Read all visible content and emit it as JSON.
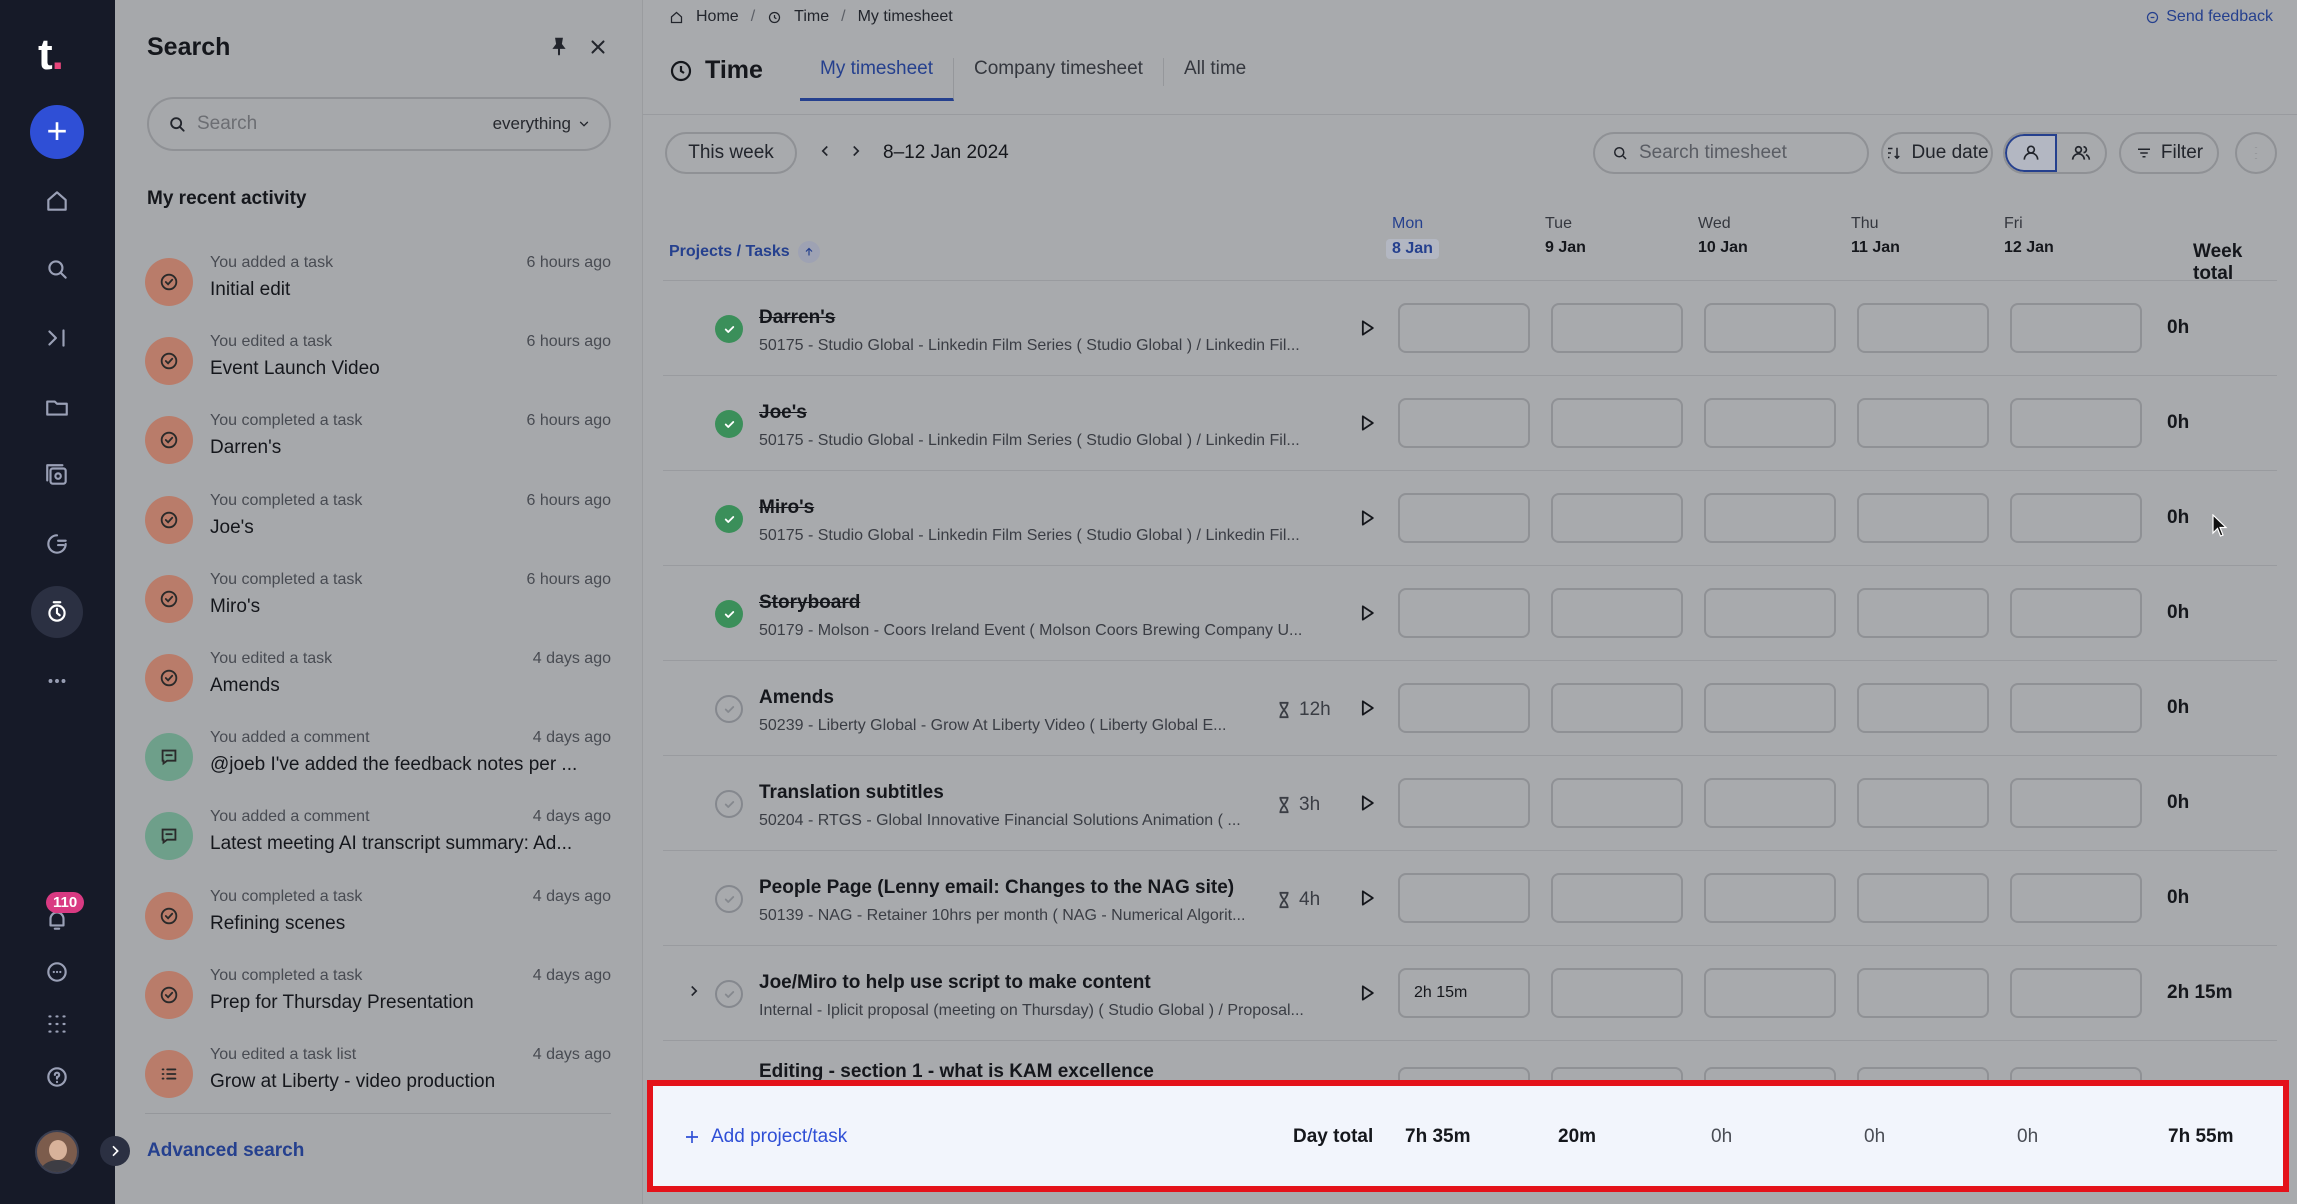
{
  "rail": {
    "logo": "t",
    "logo_dot": ".",
    "notification_count": "110",
    "icons": [
      "home-icon",
      "search-icon",
      "jump-icon",
      "folder-icon",
      "gallery-icon",
      "refresh-chat-icon",
      "timer-icon",
      "more-icon",
      "bell-icon",
      "chat-icon",
      "apps-grid-icon",
      "help-icon"
    ]
  },
  "search_panel": {
    "title": "Search",
    "search_placeholder": "Search",
    "scope": "everything",
    "section_title": "My recent activity",
    "advanced_search": "Advanced search",
    "activity": [
      {
        "meta": "You added a task",
        "when": "6 hours ago",
        "name": "Initial edit",
        "kind": "task"
      },
      {
        "meta": "You edited a task",
        "when": "6 hours ago",
        "name": "Event Launch Video",
        "kind": "task"
      },
      {
        "meta": "You completed a task",
        "when": "6 hours ago",
        "name": "Darren's",
        "kind": "task"
      },
      {
        "meta": "You completed a task",
        "when": "6 hours ago",
        "name": "Joe's",
        "kind": "task"
      },
      {
        "meta": "You completed a task",
        "when": "6 hours ago",
        "name": "Miro's",
        "kind": "task"
      },
      {
        "meta": "You edited a task",
        "when": "4 days ago",
        "name": "Amends",
        "kind": "task"
      },
      {
        "meta": "You added a comment",
        "when": "4 days ago",
        "name": "@joeb I've added the feedback notes per ...",
        "kind": "comment"
      },
      {
        "meta": "You added a comment",
        "when": "4 days ago",
        "name": "Latest meeting AI transcript summary: Ad...",
        "kind": "comment"
      },
      {
        "meta": "You completed a task",
        "when": "4 days ago",
        "name": "Refining scenes",
        "kind": "task"
      },
      {
        "meta": "You completed a task",
        "when": "4 days ago",
        "name": "Prep for Thursday Presentation",
        "kind": "task"
      },
      {
        "meta": "You edited a task list",
        "when": "4 days ago",
        "name": "Grow at Liberty - video production",
        "kind": "list"
      }
    ]
  },
  "main": {
    "breadcrumb": [
      "Home",
      "Time",
      "My timesheet"
    ],
    "send_feedback": "Send feedback",
    "title": "Time",
    "tabs": [
      "My timesheet",
      "Company timesheet",
      "All time"
    ],
    "toolbar": {
      "this_week": "This week",
      "range": "8–12 Jan 2024",
      "search_placeholder": "Search timesheet",
      "sort": "Due date",
      "filter": "Filter"
    },
    "header": {
      "projects_tasks": "Projects / Tasks",
      "week_total": "Week total",
      "days": [
        {
          "name": "Mon",
          "date": "8 Jan"
        },
        {
          "name": "Tue",
          "date": "9 Jan"
        },
        {
          "name": "Wed",
          "date": "10 Jan"
        },
        {
          "name": "Thu",
          "date": "11 Jan"
        },
        {
          "name": "Fri",
          "date": "12 Jan"
        }
      ]
    },
    "rows": [
      {
        "task": "Darren's",
        "project": "50175 - Studio Global - Linkedin Film Series ( Studio Global ) / Linkedin Fil...",
        "done": true,
        "estimate": "",
        "cells": [
          "",
          "",
          "",
          "",
          ""
        ],
        "total": "0h"
      },
      {
        "task": "Joe's",
        "project": "50175 - Studio Global - Linkedin Film Series ( Studio Global ) / Linkedin Fil...",
        "done": true,
        "estimate": "",
        "cells": [
          "",
          "",
          "",
          "",
          ""
        ],
        "total": "0h"
      },
      {
        "task": "Miro's",
        "project": "50175 - Studio Global - Linkedin Film Series ( Studio Global ) / Linkedin Fil...",
        "done": true,
        "estimate": "",
        "cells": [
          "",
          "",
          "",
          "",
          ""
        ],
        "total": "0h"
      },
      {
        "task": "Storyboard",
        "project": "50179 - Molson - Coors Ireland Event ( Molson Coors Brewing Company U...",
        "done": true,
        "estimate": "",
        "cells": [
          "",
          "",
          "",
          "",
          ""
        ],
        "total": "0h"
      },
      {
        "task": "Amends",
        "project": "50239 - Liberty Global - Grow At Liberty Video ( Liberty Global E...",
        "done": false,
        "estimate": "12h",
        "cells": [
          "",
          "",
          "",
          "",
          ""
        ],
        "total": "0h"
      },
      {
        "task": "Translation subtitles",
        "project": "50204 - RTGS - Global Innovative Financial Solutions Animation ( ...",
        "done": false,
        "estimate": "3h",
        "cells": [
          "",
          "",
          "",
          "",
          ""
        ],
        "total": "0h"
      },
      {
        "task": "People Page (Lenny email: Changes to the NAG site)",
        "project": "50139 - NAG - Retainer 10hrs per month ( NAG - Numerical Algorit...",
        "done": false,
        "estimate": "4h",
        "cells": [
          "",
          "",
          "",
          "",
          ""
        ],
        "total": "0h"
      },
      {
        "task": "Joe/Miro to help use script to make content",
        "project": "Internal - Iplicit proposal (meeting on Thursday) ( Studio Global ) / Proposal...",
        "done": false,
        "estimate": "",
        "cells": [
          "2h 15m",
          "",
          "",
          "",
          ""
        ],
        "total": "2h 15m",
        "expandable": true
      },
      {
        "task": "Editing - section 1 - what is KAM excellence",
        "project": "",
        "done": false,
        "estimate": "",
        "cells": [
          "",
          "",
          "",
          "",
          ""
        ],
        "total": ""
      }
    ],
    "footer": {
      "add": "Add project/task",
      "day_total_label": "Day total",
      "day_totals": [
        "7h 35m",
        "20m",
        "0h",
        "0h",
        "0h"
      ],
      "week_total": "7h 55m"
    }
  }
}
